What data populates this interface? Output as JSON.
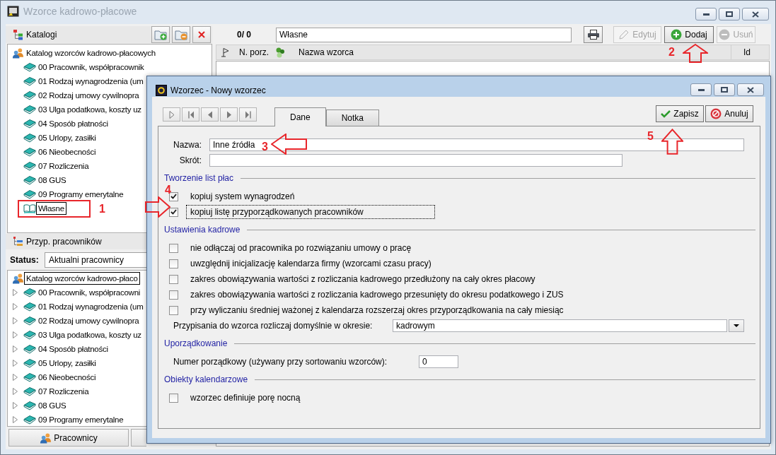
{
  "window": {
    "title": "Wzorce kadrowo-płacowe",
    "active": false
  },
  "catalogs": {
    "title": "Katalogi",
    "tree": {
      "label": "Katalog wzorców kadrowo-płacowych",
      "selected": false,
      "children": [
        {
          "label": "00 Pracownik, współpracownik",
          "kind": "book",
          "selected": false
        },
        {
          "label": "01 Rodzaj wynagrodzenia (um",
          "kind": "book",
          "selected": false
        },
        {
          "label": "02 Rodzaj umowy cywilnopra",
          "kind": "book",
          "selected": false
        },
        {
          "label": "03 Ulga podatkowa, koszty uz",
          "kind": "book",
          "selected": false
        },
        {
          "label": "04 Sposób płatności",
          "kind": "book",
          "selected": false
        },
        {
          "label": "05 Urlopy, zasiłki",
          "kind": "book",
          "selected": false
        },
        {
          "label": "06 Nieobecności",
          "kind": "book",
          "selected": false
        },
        {
          "label": "07 Rozliczenia",
          "kind": "book",
          "selected": false
        },
        {
          "label": "08 GUS",
          "kind": "book",
          "selected": false
        },
        {
          "label": "09 Programy emerytalne",
          "kind": "book",
          "selected": false
        },
        {
          "label": "Własne",
          "kind": "open_book",
          "selected": true
        }
      ]
    }
  },
  "employees": {
    "title": "Przyp. pracowników",
    "status_label": "Status:",
    "status_value": "Aktualni pracownicy",
    "tree": {
      "label": "Katalog wzorców kadrowo-płaco",
      "selected": true,
      "children": [
        {
          "label": "00 Pracownik, współpracowni",
          "expanded": false,
          "selected": false
        },
        {
          "label": "01 Rodzaj wynagrodzenia (um",
          "expanded": false,
          "selected": false
        },
        {
          "label": "02 Rodzaj umowy cywilnopra",
          "expanded": false,
          "selected": false
        },
        {
          "label": "03 Ulga podatkowa, koszty uz",
          "expanded": false,
          "selected": false
        },
        {
          "label": "04 Sposób płatności",
          "expanded": false,
          "selected": false
        },
        {
          "label": "05 Urlopy, zasiłki",
          "expanded": false,
          "selected": false
        },
        {
          "label": "06 Nieobecności",
          "expanded": false,
          "selected": false
        },
        {
          "label": "07 Rozliczenia",
          "expanded": false,
          "selected": false
        },
        {
          "label": "08 GUS",
          "expanded": false,
          "selected": false
        },
        {
          "label": "09 Programy emerytalne",
          "expanded": false,
          "selected": false
        }
      ]
    },
    "footer_buttons": [
      {
        "label": "Pracownicy"
      }
    ]
  },
  "list": {
    "counter": "0/ 0",
    "filter": "Własne",
    "buttons": [
      {
        "label": "Edytuj",
        "disabled": true
      },
      {
        "label": "Dodaj",
        "disabled": false
      },
      {
        "label": "Usuń",
        "disabled": true
      }
    ],
    "columns": [
      "N. porz.",
      "Nazwa wzorca",
      "Id"
    ]
  },
  "dialog": {
    "title": "Wzorzec - Nowy wzorzec",
    "active": true,
    "tabs": [
      {
        "label": "Dane",
        "selected": true
      },
      {
        "label": "Notka",
        "selected": false
      }
    ],
    "buttons": [
      {
        "label": "Zapisz"
      },
      {
        "label": "Anuluj"
      }
    ],
    "fields": [
      {
        "label": "Nazwa:",
        "value": "Inne źródła"
      },
      {
        "label": "Skrót:"
      }
    ],
    "sections": [
      {
        "title": "Tworzenie list płac",
        "items": [
          {
            "kind": "checkbox",
            "label": "kopiuj system wynagrodzeń",
            "checked": true,
            "focused": false
          },
          {
            "kind": "checkbox",
            "label": "kopiuj listę przyporządkowanych pracowników",
            "checked": true,
            "focused": true
          }
        ]
      },
      {
        "title": "Ustawienia kadrowe",
        "items": [
          {
            "kind": "checkbox",
            "label": "nie odłączaj od pracownika po rozwiązaniu umowy o pracę",
            "checked": false,
            "focused": false
          },
          {
            "kind": "checkbox",
            "label": "uwzględnij inicjalizację kalendarza firmy (wzorcami czasu pracy)",
            "checked": false,
            "focused": false
          },
          {
            "kind": "checkbox",
            "label": "zakres obowiązywania wartości z rozliczania kadrowego przedłużony na cały okres płacowy",
            "checked": false,
            "focused": false
          },
          {
            "kind": "checkbox",
            "label": "zakres obowiązywania wartości z rozliczania kadrowego przesunięty do okresu podatkowego i ZUS",
            "checked": false,
            "focused": false
          },
          {
            "kind": "checkbox",
            "label": "przy wyliczaniu średniej ważonej z kalendarza rozszerzaj okres przyporządkowania na cały miesiąc",
            "checked": false,
            "focused": false
          },
          {
            "kind": "dropdown",
            "label": "Przypisania do wzorca rozliczaj domyślnie w okresie:",
            "value": "kadrowym"
          }
        ]
      },
      {
        "title": "Uporządkowanie",
        "items": [
          {
            "kind": "number",
            "label": "Numer porządkowy (używany przy sortowaniu wzorców):",
            "value": "0"
          }
        ]
      },
      {
        "title": "Obiekty kalendarzowe",
        "items": [
          {
            "kind": "checkbox",
            "label": "wzorzec definiuje porę nocną",
            "checked": false,
            "focused": false
          }
        ]
      }
    ]
  },
  "annotations": [
    {
      "label": "1",
      "kind": "frame"
    },
    {
      "label": "2",
      "kind": "arrow_up"
    },
    {
      "label": "3",
      "kind": "arrow_left"
    },
    {
      "label": "4",
      "kind": "arrow_right"
    },
    {
      "label": "5",
      "kind": "arrow_up"
    }
  ]
}
